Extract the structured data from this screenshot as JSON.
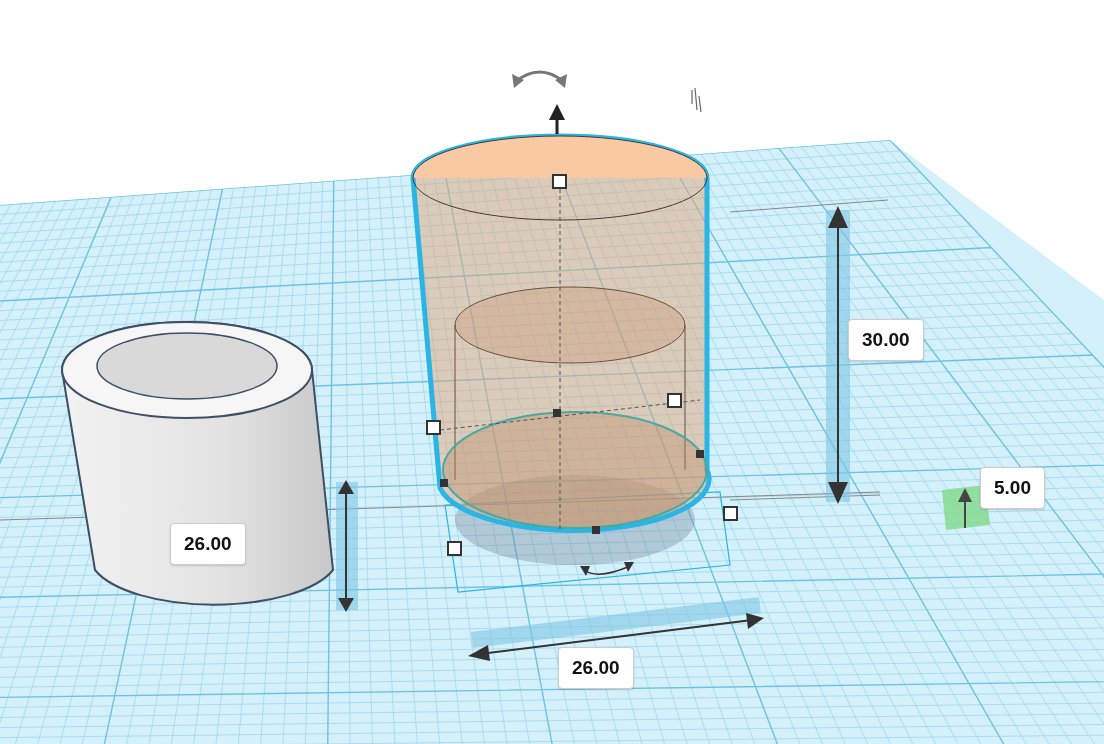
{
  "dimension_labels": [
    "30.00",
    "5.00",
    "26.00",
    "26.00"
  ]
}
